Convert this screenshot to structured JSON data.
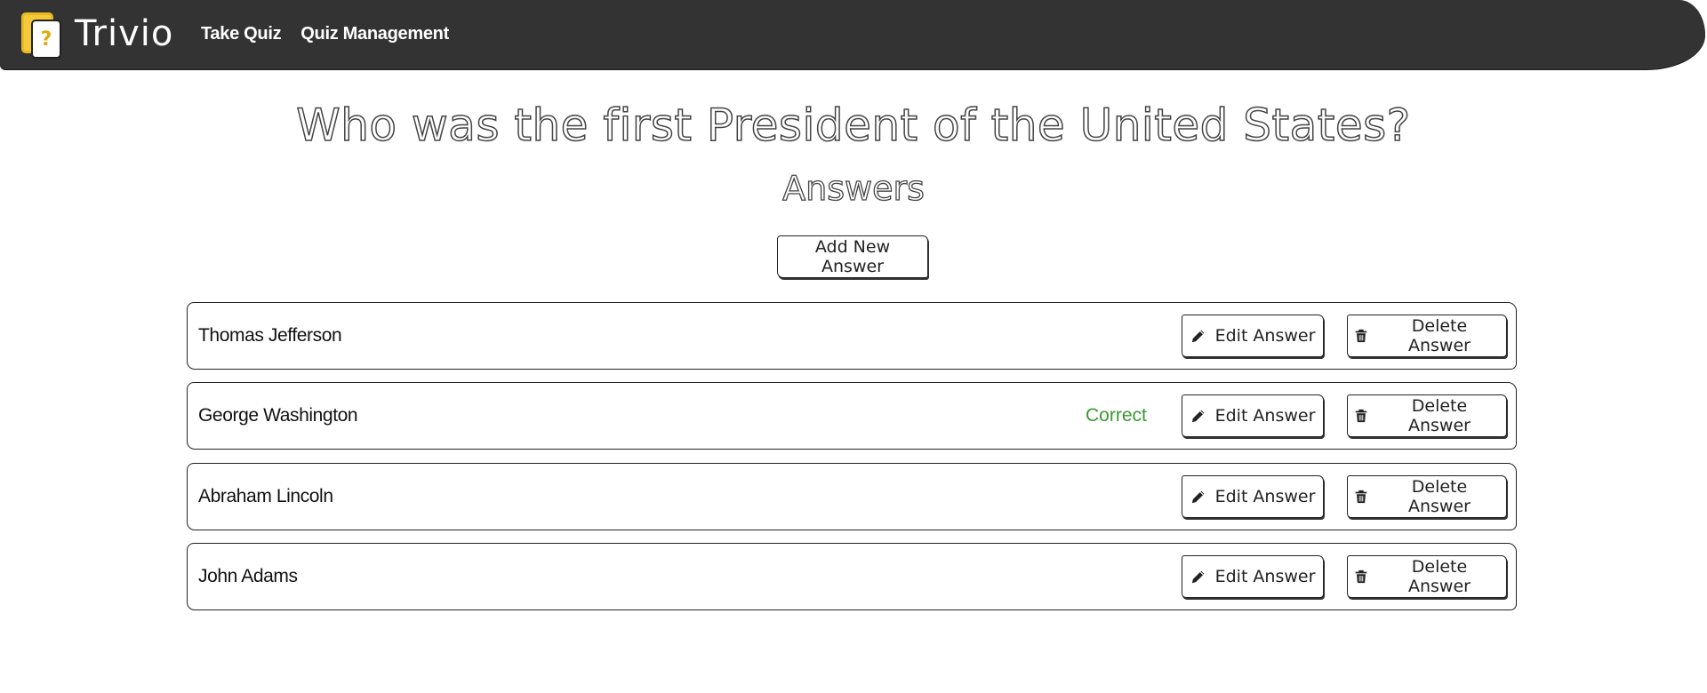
{
  "navbar": {
    "brand_name": "Trivio",
    "logo_glyph": "?",
    "links": [
      "Take Quiz",
      "Quiz Management"
    ]
  },
  "question": {
    "title": "Who was the first President of the United States?"
  },
  "answers_heading": "Answers",
  "add_button_label": "Add New Answer",
  "answers": [
    {
      "text": "Thomas Jefferson",
      "correct_label": ""
    },
    {
      "text": "George Washington",
      "correct_label": "Correct"
    },
    {
      "text": "Abraham Lincoln",
      "correct_label": ""
    },
    {
      "text": "John Adams",
      "correct_label": ""
    }
  ],
  "actions": {
    "edit_label": "Edit Answer",
    "delete_label": "Delete Answer",
    "edit_icon": "pencil-icon",
    "delete_icon": "trash-icon"
  },
  "colors": {
    "navbar_bg": "#333333",
    "logo_accent": "#f4c93a",
    "correct": "#3a9a2e"
  }
}
